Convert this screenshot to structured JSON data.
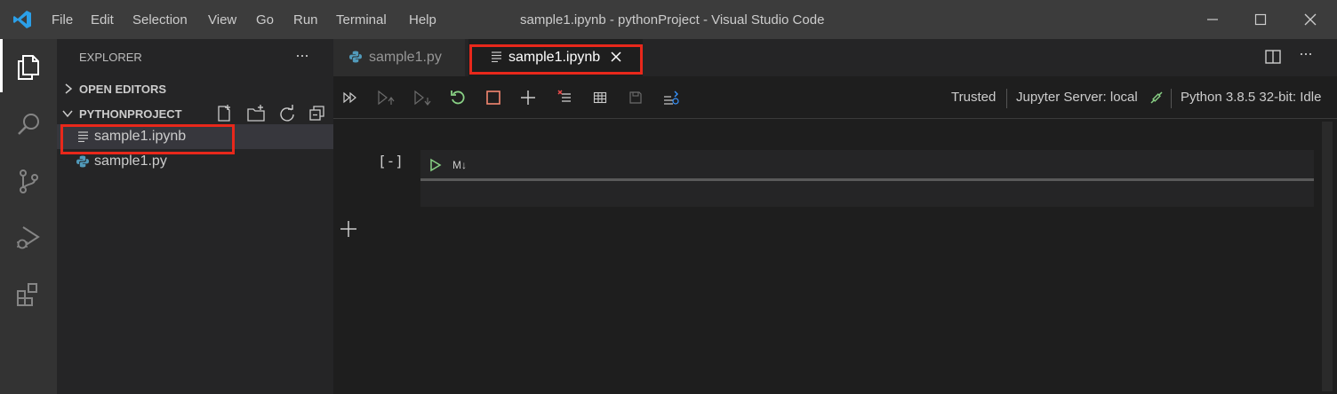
{
  "titlebar": {
    "menu": [
      "File",
      "Edit",
      "Selection",
      "View",
      "Go",
      "Run",
      "Terminal",
      "Help"
    ],
    "window_title": "sample1.ipynb - pythonProject - Visual Studio Code"
  },
  "sidebar": {
    "header": "EXPLORER",
    "more": "···",
    "open_editors": "OPEN EDITORS",
    "project": "PYTHONPROJECT",
    "files": [
      "sample1.ipynb",
      "sample1.py"
    ]
  },
  "tabs": [
    {
      "label": "sample1.py",
      "icon": "python-icon"
    },
    {
      "label": "sample1.ipynb",
      "icon": "notebook-icon",
      "active": true
    }
  ],
  "toolbar": {
    "trusted": "Trusted",
    "jupyter_server": "Jupyter Server: local",
    "kernel": "Python 3.8.5 32-bit: Idle"
  },
  "cell": {
    "execution_count": "[-]",
    "type_label": "M↓"
  },
  "colors": {
    "accent": "#007acc",
    "highlight": "#e8281b",
    "run_green": "#89d185",
    "stop_orange": "#f48771"
  }
}
